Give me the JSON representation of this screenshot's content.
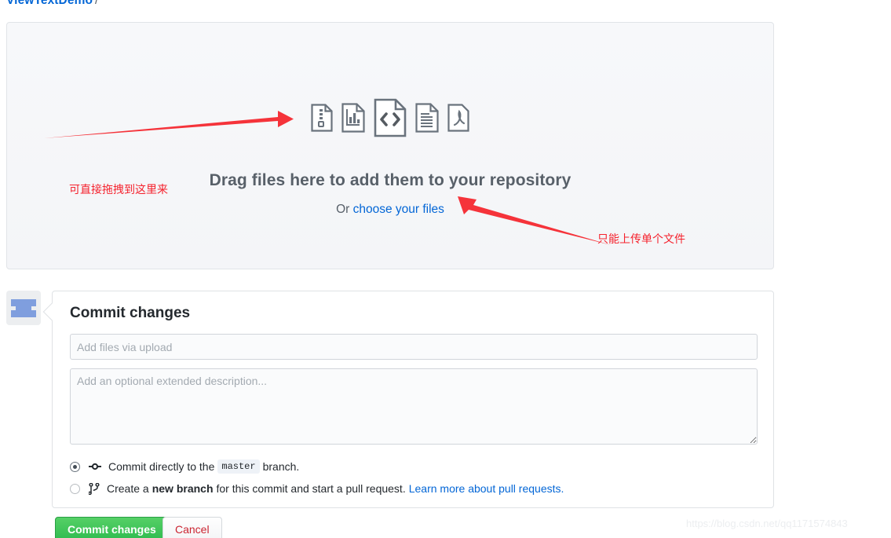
{
  "breadcrumb": {
    "repo": "ViewTextDemo",
    "separator": "/"
  },
  "dropzone": {
    "title": "Drag files here to add them to your repository",
    "or_prefix": "Or ",
    "choose_link": "choose your files",
    "file_icons": [
      "archive-file-icon",
      "spreadsheet-file-icon",
      "code-file-icon",
      "text-file-icon",
      "pdf-file-icon"
    ]
  },
  "annotations": {
    "left_note": "可直接拖拽到这里来",
    "right_note": "只能上传单个文件",
    "arrow_color": "#f5333a"
  },
  "commit": {
    "title": "Commit changes",
    "summary_placeholder": "Add files via upload",
    "summary_value": "",
    "description_placeholder": "Add an optional extended description...",
    "description_value": "",
    "options": [
      {
        "selected": true,
        "icon": "git-commit-icon",
        "text_before": "Commit directly to the",
        "branch": "master",
        "text_after": "branch."
      },
      {
        "selected": false,
        "icon": "git-branch-icon",
        "text_before": "Create a",
        "emphasis": "new branch",
        "text_after": "for this commit and start a pull request.",
        "link": "Learn more about pull requests."
      }
    ]
  },
  "footer": {
    "commit_button": "Commit changes",
    "cancel_button": "Cancel",
    "commit_color": "#2dba4e",
    "cancel_color": "#cb2431"
  },
  "watermark": {
    "text": "https://blog.csdn.net/qq1171574843"
  }
}
